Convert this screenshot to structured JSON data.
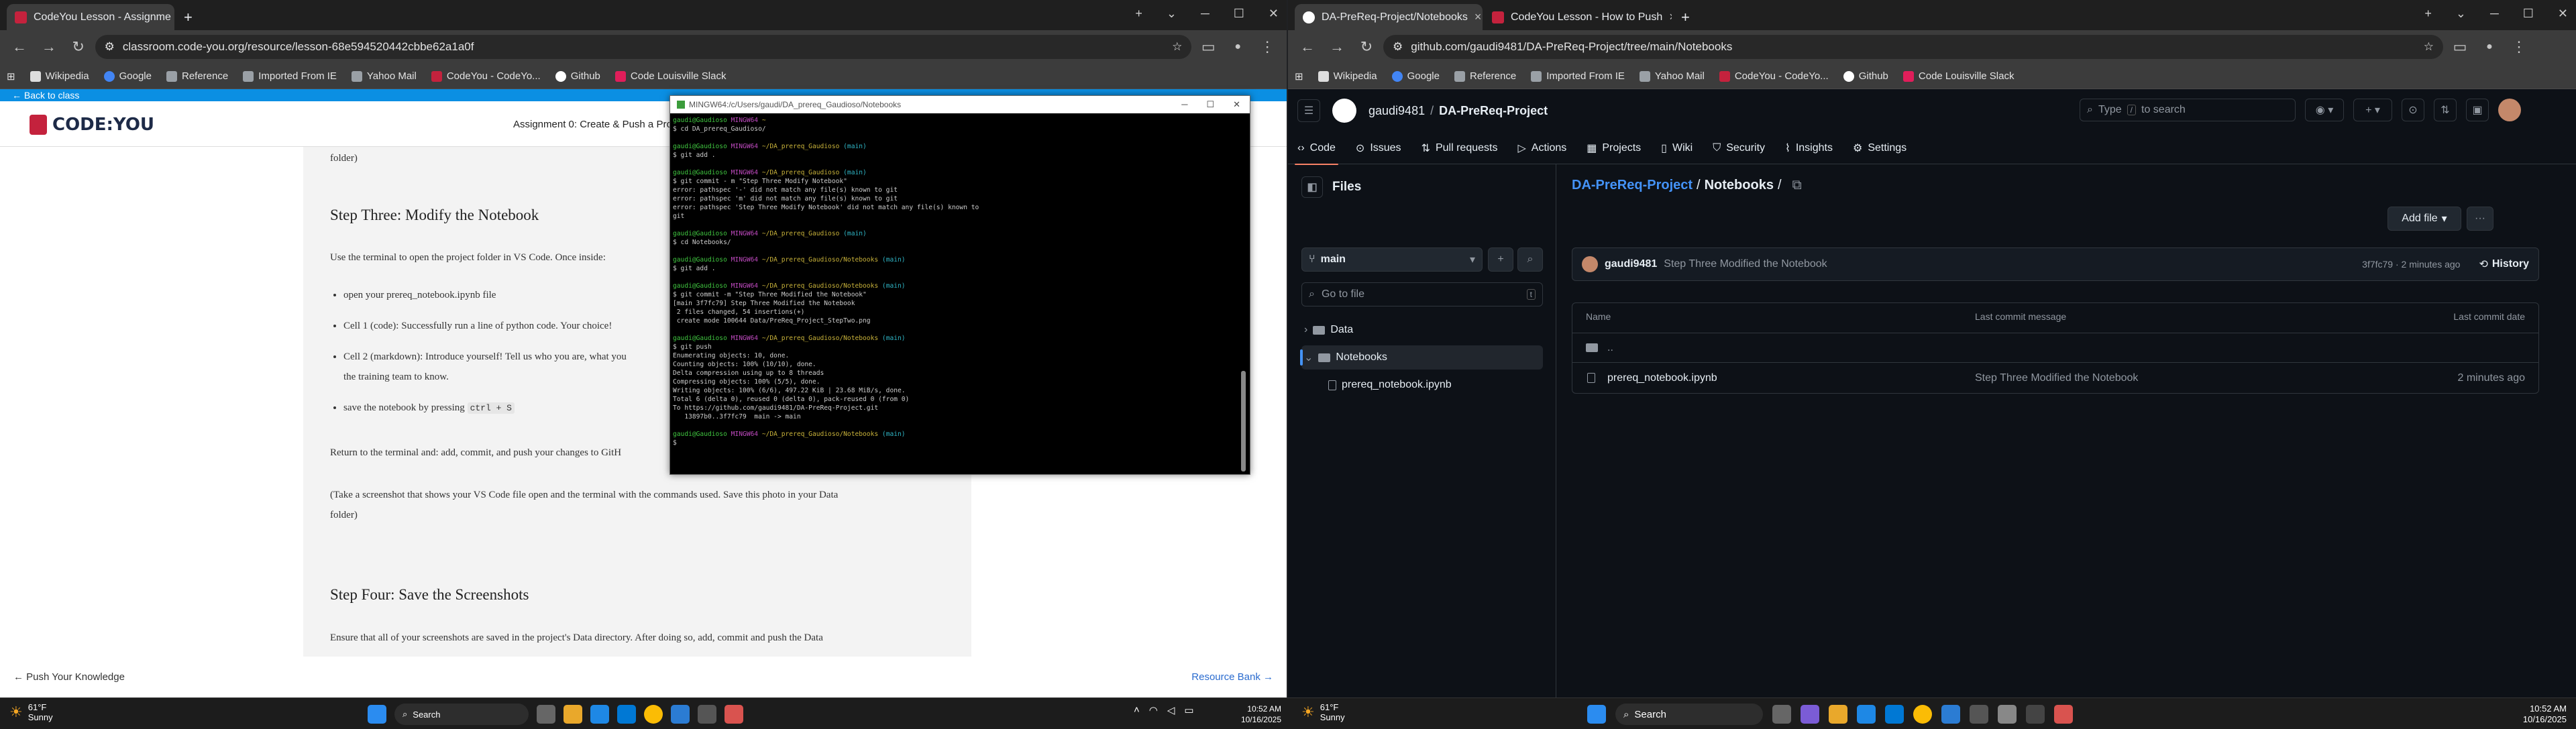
{
  "left_browser": {
    "tabs": [
      {
        "title": "CodeYou Lesson - Assignme",
        "active": true
      },
      {
        "title": "+",
        "active": false
      }
    ],
    "url": "classroom.code-you.org/resource/lesson-68e594520442cbbe62a1a0f",
    "bookmarks": [
      "Wikipedia",
      "Google",
      "Reference",
      "Imported From IE",
      "Yahoo Mail",
      "CodeYou - CodeYo...",
      "Github",
      "Code Louisville Slack"
    ],
    "back_link": "← Back to class",
    "logo": "CODE:YOU",
    "assignment_title": "Assignment 0: Create & Push a Proj",
    "content": {
      "top_fragment": "folder)",
      "h_step3": "Step Three: Modify the Notebook",
      "p_open": "Use the terminal to open the project folder in VS Code. Once inside:",
      "li1": "open your prereq_notebook.ipynb file",
      "li2": "Cell 1 (code): Successfully run a line of python code. Your choice!",
      "li3a": "Cell 2 (markdown): Introduce yourself! Tell us who you are, what you",
      "li3b": "the training team to know.",
      "li4": "save the notebook by pressing",
      "li4_key": "ctrl + S",
      "p_return": "Return to the terminal and: add, commit, and push your changes to GitH",
      "p_shot1": "(Take a screenshot that shows your VS Code file open and the terminal with the commands used. Save this photo in your Data",
      "p_shot2": "folder)",
      "h_step4": "Step Four: Save the Screenshots",
      "p_ensure": "Ensure that all of your screenshots are saved in the project's Data directory. After doing so, add, commit and push the Data"
    },
    "footer_prev": "← Push Your Knowledge",
    "footer_next": "Resource Bank →"
  },
  "terminal": {
    "title": "MINGW64:/c/Users/gaudi/DA_prereq_Gaudioso/Notebooks",
    "lines": [
      {
        "p": "gaudi@Gaudioso MINGW64 ~",
        "b": ""
      },
      {
        "t": "$ cd DA_prereq_Gaudioso/"
      },
      {
        "t": ""
      },
      {
        "p": "gaudi@Gaudioso MINGW64 ~/DA_prereq_Gaudioso",
        "b": "(main)"
      },
      {
        "t": "$ git add ."
      },
      {
        "t": ""
      },
      {
        "p": "gaudi@Gaudioso MINGW64 ~/DA_prereq_Gaudioso",
        "b": "(main)"
      },
      {
        "t": "$ git commit - m \"Step Three Modify Notebook\""
      },
      {
        "t": "error: pathspec '-' did not match any file(s) known to git"
      },
      {
        "t": "error: pathspec 'm' did not match any file(s) known to git"
      },
      {
        "t": "error: pathspec 'Step Three Modify Notebook' did not match any file(s) known to"
      },
      {
        "t": "git"
      },
      {
        "t": ""
      },
      {
        "p": "gaudi@Gaudioso MINGW64 ~/DA_prereq_Gaudioso",
        "b": "(main)"
      },
      {
        "t": "$ cd Notebooks/"
      },
      {
        "t": ""
      },
      {
        "p": "gaudi@Gaudioso MINGW64 ~/DA_prereq_Gaudioso/Notebooks",
        "b": "(main)"
      },
      {
        "t": "$ git add ."
      },
      {
        "t": ""
      },
      {
        "p": "gaudi@Gaudioso MINGW64 ~/DA_prereq_Gaudioso/Notebooks",
        "b": "(main)"
      },
      {
        "t": "$ git commit -m \"Step Three Modified the Notebook\""
      },
      {
        "t": "[main 3f7fc79] Step Three Modified the Notebook"
      },
      {
        "t": " 2 files changed, 54 insertions(+)"
      },
      {
        "t": " create mode 100644 Data/PreReq_Project_StepTwo.png"
      },
      {
        "t": ""
      },
      {
        "p": "gaudi@Gaudioso MINGW64 ~/DA_prereq_Gaudioso/Notebooks",
        "b": "(main)"
      },
      {
        "t": "$ git push"
      },
      {
        "t": "Enumerating objects: 10, done."
      },
      {
        "t": "Counting objects: 100% (10/10), done."
      },
      {
        "t": "Delta compression using up to 8 threads"
      },
      {
        "t": "Compressing objects: 100% (5/5), done."
      },
      {
        "t": "Writing objects: 100% (6/6), 497.22 KiB | 23.68 MiB/s, done."
      },
      {
        "t": "Total 6 (delta 0), reused 0 (delta 0), pack-reused 0 (from 0)"
      },
      {
        "t": "To https://github.com/gaudi9481/DA-PreReq-Project.git"
      },
      {
        "t": "   13897b0..3f7fc79  main -> main"
      },
      {
        "t": ""
      },
      {
        "p": "gaudi@Gaudioso MINGW64 ~/DA_prereq_Gaudioso/Notebooks",
        "b": "(main)"
      },
      {
        "t": "$"
      }
    ]
  },
  "right_browser": {
    "tabs": [
      {
        "title": "DA-PreReq-Project/Notebooks",
        "active": true
      },
      {
        "title": "CodeYou Lesson - How to Push",
        "active": false
      }
    ],
    "url": "github.com/gaudi9481/DA-PreReq-Project/tree/main/Notebooks",
    "bookmarks": [
      "Wikipedia",
      "Google",
      "Reference",
      "Imported From IE",
      "Yahoo Mail",
      "CodeYou - CodeYo...",
      "Github",
      "Code Louisville Slack"
    ],
    "owner": "gaudi9481",
    "repo": "DA-PreReq-Project",
    "search_placeholder_a": "Type",
    "search_key": "/",
    "search_placeholder_b": "to search",
    "nav": [
      "Code",
      "Issues",
      "Pull requests",
      "Actions",
      "Projects",
      "Wiki",
      "Security",
      "Insights",
      "Settings"
    ],
    "files_title": "Files",
    "branch": "main",
    "goto_placeholder": "Go to file",
    "goto_key": "t",
    "tree": [
      {
        "name": "Data",
        "open": false
      },
      {
        "name": "Notebooks",
        "open": true
      },
      {
        "name": "prereq_notebook.ipynb",
        "open": false
      }
    ],
    "breadcrumb_repo": "DA-PreReq-Project",
    "breadcrumb_dir": "Notebooks",
    "breadcrumb_sep": "/",
    "add_file": "Add file",
    "commit_user": "gaudi9481",
    "commit_msg": "Step Three Modified the Notebook",
    "commit_meta": "3f7fc79 · 2 minutes ago",
    "history": "History",
    "col_name": "Name",
    "col_msg": "Last commit message",
    "col_date": "Last commit date",
    "parent": "..",
    "file_name": "prereq_notebook.ipynb",
    "file_msg": "Step Three Modified the Notebook",
    "file_date": "2 minutes ago"
  },
  "taskbar_left": {
    "temp": "61°F",
    "cond": "Sunny",
    "search": "Search",
    "time": "10:52 AM",
    "date": "10/16/2025"
  },
  "taskbar_right": {
    "temp": "61°F",
    "cond": "Sunny",
    "search": "Search",
    "time": "10:52 AM",
    "date": "10/16/2025"
  },
  "colors": {
    "codeyou_red": "#c4223d",
    "github_bg": "#0d1117",
    "link_blue": "#4493f8",
    "terminal_green": "#3fc43f"
  }
}
